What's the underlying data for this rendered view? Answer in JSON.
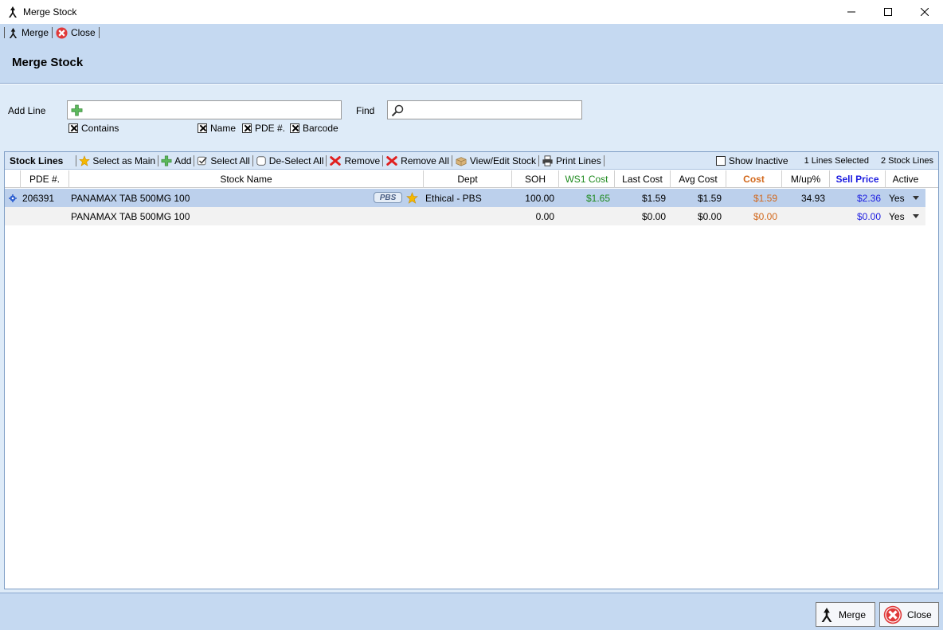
{
  "window": {
    "title": "Merge Stock",
    "controls": [
      "—",
      "☐",
      "✕"
    ]
  },
  "mini_toolbar": {
    "merge_label": "Merge",
    "close_label": "Close"
  },
  "page": {
    "title": "Merge Stock"
  },
  "form": {
    "add_line_label": "Add Line",
    "add_line_value": "",
    "find_label": "Find",
    "find_value": "",
    "options": [
      {
        "label": "Contains",
        "checked": true
      },
      {
        "label": "Name",
        "checked": true
      },
      {
        "label": "PDE #.",
        "checked": true
      },
      {
        "label": "Barcode",
        "checked": true
      }
    ]
  },
  "grid_toolbar": {
    "title": "Stock Lines",
    "select_as_main": "Select as Main",
    "add": "Add",
    "select_all": "Select All",
    "deselect_all": "De-Select All",
    "remove": "Remove",
    "remove_all": "Remove All",
    "view_edit": "View/Edit Stock",
    "print_lines": "Print Lines",
    "show_inactive": "Show Inactive",
    "show_inactive_checked": false,
    "lines_selected": "1 Lines Selected",
    "stock_lines_count": "2 Stock Lines"
  },
  "columns": [
    "PDE #.",
    "Stock Name",
    "Dept",
    "SOH",
    "WS1 Cost",
    "Last Cost",
    "Avg Cost",
    "Cost",
    "M/up%",
    "Sell Price",
    "Active"
  ],
  "rows": [
    {
      "pde": "206391",
      "name": "PANAMAX TAB 500MG 100",
      "badge": "PBS",
      "dept": "Ethical - PBS",
      "soh": "100.00",
      "ws1": "$1.65",
      "last": "$1.59",
      "avg": "$1.59",
      "cost": "$1.59",
      "mup": "34.93",
      "sell": "$2.36",
      "active": "Yes"
    },
    {
      "pde": "",
      "name": "PANAMAX TAB 500MG 100",
      "badge": "",
      "dept": "",
      "soh": "0.00",
      "ws1": "",
      "last": "$0.00",
      "avg": "$0.00",
      "cost": "$0.00",
      "mup": "",
      "sell": "$0.00",
      "active": "Yes"
    }
  ],
  "buttons": {
    "merge": "Merge",
    "close": "Close"
  },
  "colors": {
    "accent": "#c5d9f1",
    "ws1": "#1e8a1e",
    "cost": "#d2691e",
    "sell": "#1d1de0"
  }
}
